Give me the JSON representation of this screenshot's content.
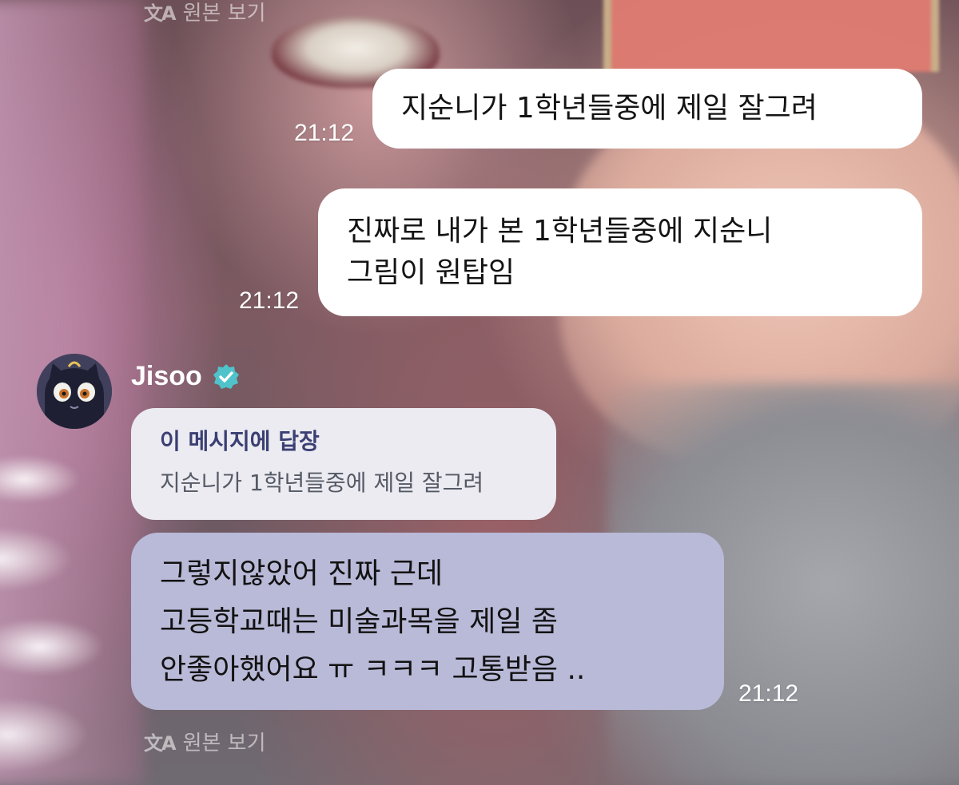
{
  "translate": {
    "icon": "translate-icon",
    "label": "원본 보기"
  },
  "messages": {
    "sent_1": {
      "text": "지순니가 1학년들중에 제일 잘그려",
      "time": "21:12"
    },
    "sent_2": {
      "lines": [
        "진짜로 내가 본 1학년들중에 지순니",
        "그림이 원탑임"
      ],
      "time": "21:12"
    }
  },
  "artist": {
    "name": "Jisoo",
    "verified_icon": "verified-badge-icon",
    "avatar_icon": "black-cat-avatar",
    "verified_color": "#4fc3c9"
  },
  "reply": {
    "title": "이 메시지에 답장",
    "quote": "지순니가 1학년들중에 제일 잘그려"
  },
  "artist_message": {
    "lines": [
      "그렇지않았어 진짜 근데",
      "고등학교때는 미술과목을 제일 좀",
      "안좋아했어요 ㅠ ㅋㅋㅋ 고통받음 .."
    ],
    "time": "21:12",
    "bubble_color": "#b9b9d8"
  }
}
